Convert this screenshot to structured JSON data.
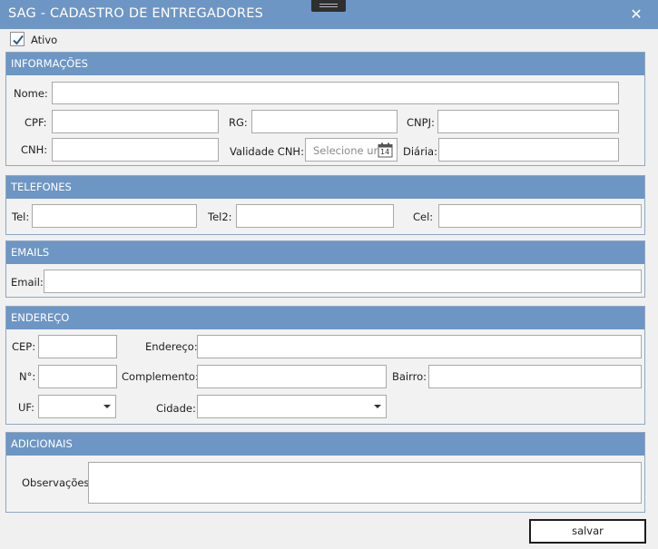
{
  "window": {
    "title": "SAG - CADASTRO DE ENTREGADORES",
    "close_glyph": "✕"
  },
  "ativo": {
    "label": "Ativo",
    "checked": true
  },
  "sections": {
    "informacoes": {
      "title": "INFORMAÇÕES",
      "nome_label": "Nome:",
      "cpf_label": "CPF:",
      "rg_label": "RG:",
      "cnpj_label": "CNPJ:",
      "cnh_label": "CNH:",
      "validade_label": "Validade CNH:",
      "validade_placeholder": "Selecione ur",
      "calendar_day": "14",
      "diaria_label": "Diária:"
    },
    "telefones": {
      "title": "TELEFONES",
      "tel_label": "Tel:",
      "tel2_label": "Tel2:",
      "cel_label": "Cel:"
    },
    "emails": {
      "title": "EMAILS",
      "email_label": "Email:"
    },
    "endereco": {
      "title": "ENDEREÇO",
      "cep_label": "CEP:",
      "endereco_label": "Endereço:",
      "numero_label": "N°:",
      "complemento_label": "Complemento:",
      "bairro_label": "Bairro:",
      "uf_label": "UF:",
      "cidade_label": "Cidade:"
    },
    "adicionais": {
      "title": "ADICIONAIS",
      "observacoes_label": "Observações"
    }
  },
  "actions": {
    "save_label": "salvar"
  },
  "colors": {
    "accent": "#6d96c4",
    "window_bg": "#f0f0f0",
    "group_border": "#8fa7c2"
  }
}
